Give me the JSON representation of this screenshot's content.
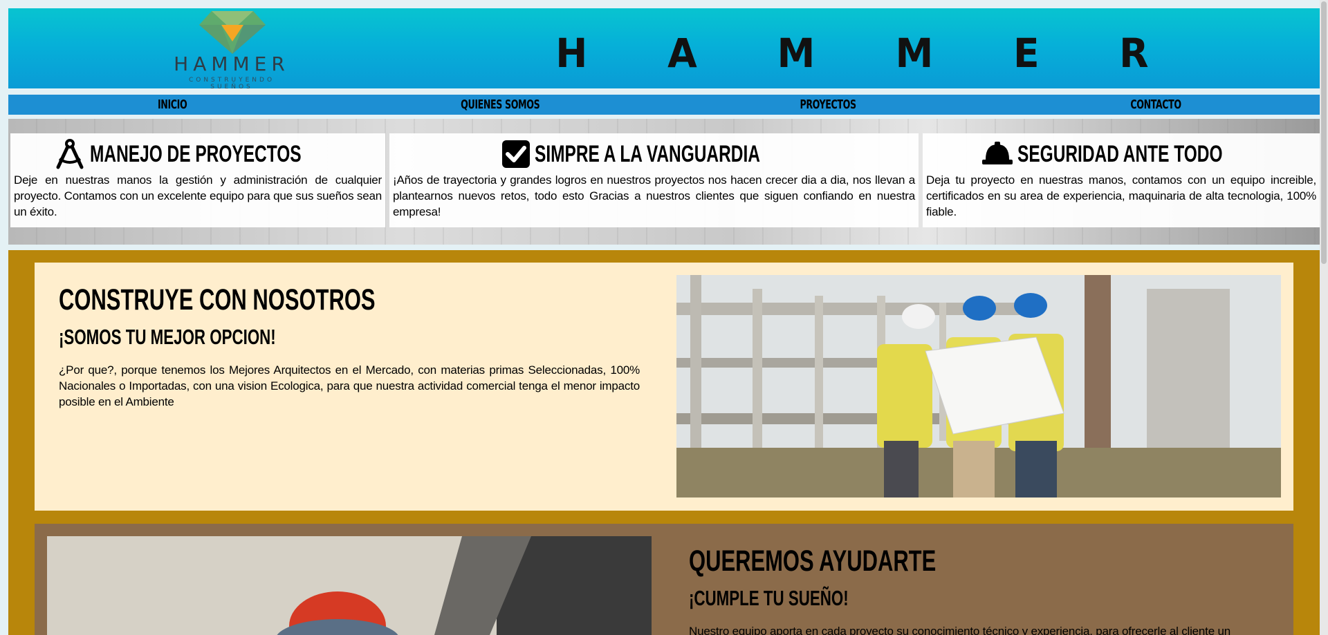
{
  "header": {
    "logo_name": "HAMMER",
    "logo_tagline": "CONSTRUYENDO SUEÑOS",
    "brand_letters": [
      "H",
      "A",
      "M",
      "M",
      "E",
      "R"
    ]
  },
  "nav": {
    "items": [
      {
        "label": "INICIO"
      },
      {
        "label": "QUIENES SOMOS"
      },
      {
        "label": "PROYECTOS"
      },
      {
        "label": "CONTACTO"
      }
    ]
  },
  "features": [
    {
      "icon": "compass-icon",
      "title": "MANEJO DE PROYECTOS",
      "text": "Deje en nuestras manos la gestión y administración de cualquier proyecto. Contamos con un excelente equipo para que sus sueños sean un éxito."
    },
    {
      "icon": "check-square-icon",
      "title": "SIMPRE A LA VANGUARDIA",
      "text": "¡Años de trayectoria y grandes logros en nuestros proyectos nos hacen crecer dia a dia, nos llevan a plantearnos nuevos retos, todo esto Gracias a nuestros clientes que siguen confiando en nuestra empresa!"
    },
    {
      "icon": "hard-hat-icon",
      "title": "SEGURIDAD ANTE TODO",
      "text": "Deja tu proyecto en nuestras manos, contamos con un equipo increible, certificados en su area de experiencia, maquinaria de alta tecnologia, 100% fiable."
    }
  ],
  "section1": {
    "title": "CONSTRUYE CON NOSOTROS",
    "subtitle": "¡SOMOS TU MEJOR OPCION!",
    "text": "¿Por que?, porque tenemos los Mejores Arquitectos en el Mercado, con materias primas Seleccionadas, 100% Nacionales o Importadas, con una vision Ecologica, para que nuestra actividad comercial tenga el menor impacto posible en el Ambiente"
  },
  "section2": {
    "title": "QUEREMOS AYUDARTE",
    "subtitle": "¡CUMPLE TU SUEÑO!",
    "text": "Nuestro equipo aporta en cada proyecto su conocimiento técnico y experiencia, para ofrecerle al cliente un"
  },
  "colors": {
    "header_top": "#08c4d0",
    "header_bottom": "#0a9bd6",
    "nav": "#1d8fd3",
    "ochre": "#b8860b",
    "card_cream": "#ffeecd",
    "card_brown": "#8b6b4a"
  }
}
